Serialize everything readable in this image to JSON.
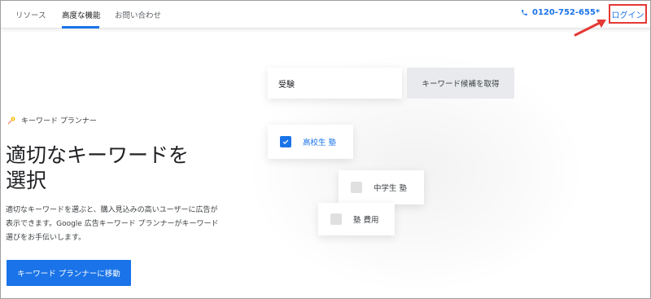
{
  "nav": {
    "items": [
      {
        "label": "リソース"
      },
      {
        "label": "高度な機能"
      },
      {
        "label": "お問い合わせ"
      }
    ],
    "phone": "0120-752-655*",
    "login": "ログイン"
  },
  "hero": {
    "product_label": "キーワード プランナー",
    "headline_line1": "適切なキーワードを",
    "headline_line2": "選択",
    "description": "適切なキーワードを選ぶと、購入見込みの高いユーザーに広告が表示できます。Google 広告キーワード プランナーがキーワード選びをお手伝いします。",
    "cta": "キーワード プランナーに移動"
  },
  "illustration": {
    "search_value": "受験",
    "get_ideas_button": "キーワード候補を取得",
    "keywords": [
      {
        "label": "高校生 塾",
        "checked": true
      },
      {
        "label": "中学生 塾",
        "checked": false
      },
      {
        "label": "塾 費用",
        "checked": false
      }
    ]
  },
  "colors": {
    "accent": "#1a73e8",
    "annotation": "#e53935"
  }
}
